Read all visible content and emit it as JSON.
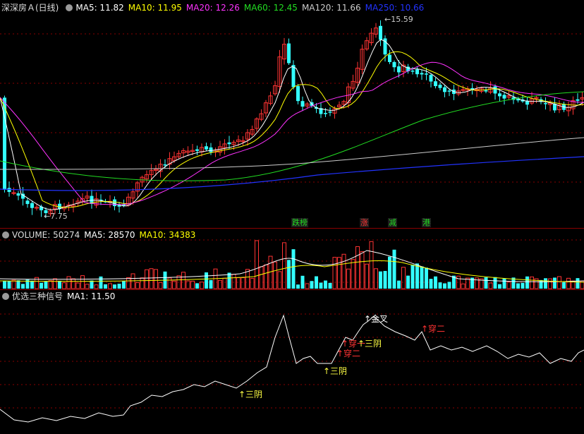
{
  "header": {
    "title": "深深房Ａ(日线)",
    "ma": [
      {
        "label": "MA5: 11.82",
        "color": "#ffffff"
      },
      {
        "label": "MA10: 11.95",
        "color": "#ffff00"
      },
      {
        "label": "MA20: 12.26",
        "color": "#ff33ff"
      },
      {
        "label": "MA60: 12.45",
        "color": "#22dd22"
      },
      {
        "label": "MA120: 11.66",
        "color": "#cccccc"
      },
      {
        "label": "MA250: 10.66",
        "color": "#2233ff"
      }
    ]
  },
  "price_labels": {
    "high": "15.59",
    "low": "7.75"
  },
  "event_tags": [
    {
      "text": "跌榜",
      "color": "#22dd22"
    },
    {
      "text": "涨",
      "color": "#ff3333"
    },
    {
      "text": "减",
      "color": "#22dd22"
    },
    {
      "text": "港",
      "color": "#22dd22"
    }
  ],
  "volume_header": {
    "vol": "VOLUME: 50274",
    "ma5": "MA5: 28570",
    "ma10": "MA10: 34383",
    "ma5_color": "#ffffff",
    "ma10_color": "#ffff00"
  },
  "indicator_header": {
    "name": "优选三种信号",
    "ma1": "MA1: 11.50"
  },
  "signals": [
    {
      "text": "↑三阴",
      "color": "#ffff44"
    },
    {
      "text": "↑三阴",
      "color": "#ffff44"
    },
    {
      "text": "↑穿二",
      "color": "#ff3333"
    },
    {
      "text": "↑穿一",
      "color": "#ff3333"
    },
    {
      "text": "↑三阴",
      "color": "#ffff44"
    },
    {
      "text": "↑金叉",
      "color": "#ffffff"
    },
    {
      "text": "↑穿二",
      "color": "#ff3333"
    }
  ],
  "colors": {
    "up": "#ff3333",
    "down": "#33ffff",
    "grid": "#8a0000"
  }
}
